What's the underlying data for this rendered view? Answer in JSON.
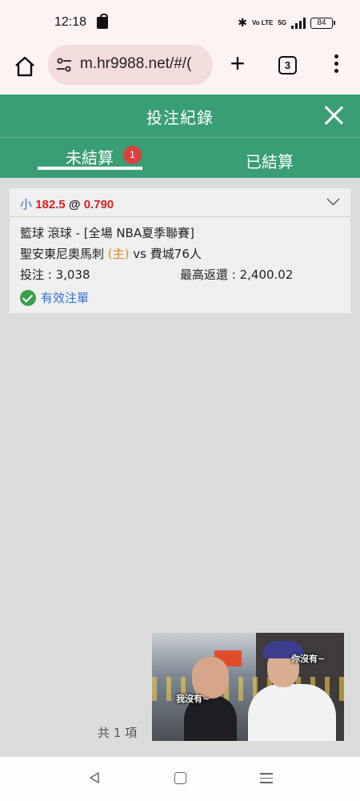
{
  "status_bar": {
    "time": "12:18",
    "bluetooth": "✱",
    "volte": "Vo LTE",
    "network": "5G",
    "battery": "84"
  },
  "browser": {
    "url": "m.hr9988.net/#/(",
    "tab_count": "3",
    "icons": [
      "home-icon",
      "site-settings-icon",
      "plus-icon",
      "tab-switcher-icon",
      "kebab-menu-icon"
    ]
  },
  "header": {
    "title": "投注紀錄",
    "close_icon": "close-icon"
  },
  "tabs": [
    {
      "label": "未結算",
      "badge": "1",
      "active": true
    },
    {
      "label": "已結算",
      "active": false
    }
  ],
  "bet": {
    "side": "小",
    "line": "182.5",
    "at": "@",
    "odds": "0.790",
    "league": "籃球 滾球 - [全場 NBA夏季聯賽]",
    "home_team": "聖安東尼奧馬刺",
    "home_tag": "(主)",
    "vs": "vs",
    "away_team": "費城76人",
    "stake_label": "投注 : 3,038",
    "max_return_label": "最高返還 : 2,400.02",
    "status": "有效注單"
  },
  "footer": {
    "total": "共 1 項"
  },
  "video": {
    "caption_1": "你沒有~",
    "caption_2": "我沒有~"
  },
  "colors": {
    "header_green": "#3a9e75",
    "badge_red": "#d9413e",
    "odds_red": "#d42323",
    "link_blue": "#2d6fd6",
    "home_orange": "#e08a1e"
  }
}
